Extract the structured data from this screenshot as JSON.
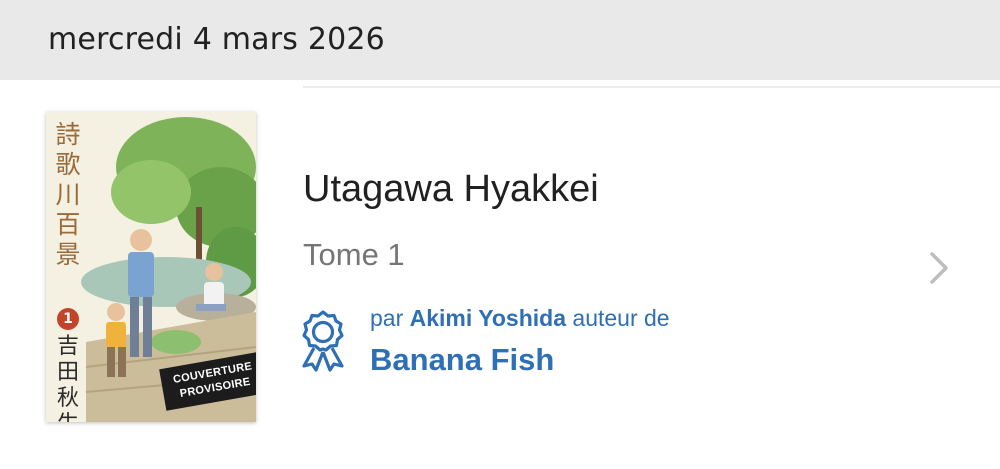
{
  "header": {
    "date": "mercredi 4 mars 2026"
  },
  "release": {
    "title": "Utagawa Hyakkei",
    "volume": "Tome 1",
    "author_prefix": "par ",
    "author_name": "Akimi Yoshida",
    "author_suffix": " auteur de",
    "series_link": "Banana Fish",
    "award_icon": "award-ribbon-icon",
    "chevron_icon": "chevron-right-icon",
    "cover": {
      "title_vertical": "詩歌川百景",
      "volume_number": "1",
      "author_vertical": "吉田秋生",
      "provisional_line1": "COUVERTURE",
      "provisional_line2": "PROVISOIRE"
    }
  },
  "colors": {
    "header_bg": "#e9e9e9",
    "link_blue": "#2e6fb5",
    "secondary_text": "#757575",
    "chevron": "#bdbdbd"
  }
}
